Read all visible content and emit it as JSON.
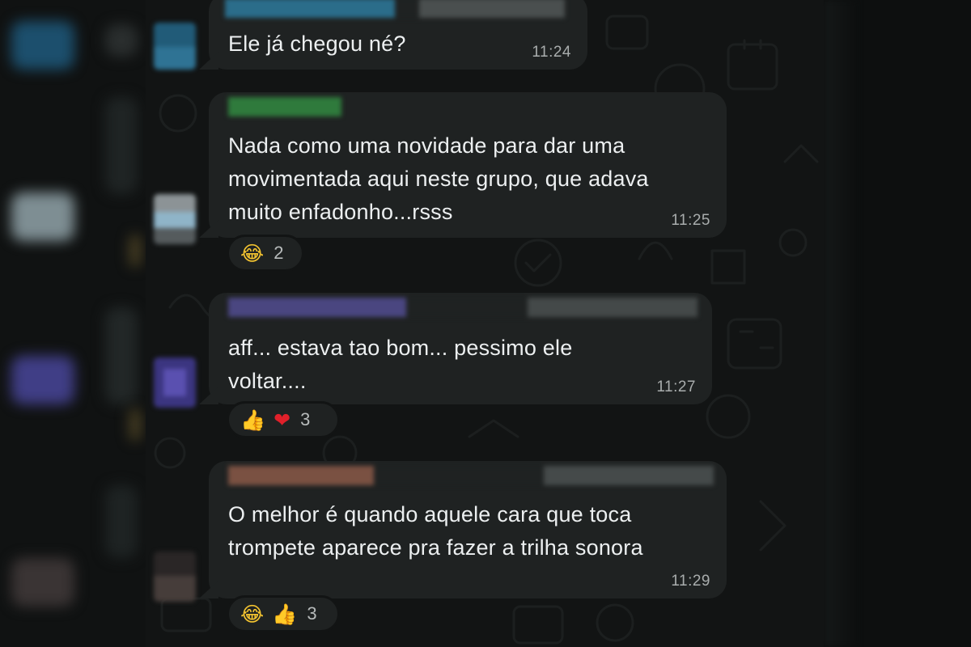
{
  "messages": [
    {
      "id": "m1",
      "text": "Ele já chegou né?",
      "time": "11:24",
      "reactions": []
    },
    {
      "id": "m2",
      "text": "Nada como uma novidade para dar uma\nmovimentada aqui neste grupo, que adava\nmuito enfadonho...rsss",
      "time": "11:25",
      "reactions": [
        {
          "icon": "laugh-emoji"
        }
      ],
      "reaction_count": "2"
    },
    {
      "id": "m3",
      "text": "aff... estava tao bom... pessimo ele\nvoltar....",
      "time": "11:27",
      "reactions": [
        {
          "icon": "thumbs-up-emoji"
        },
        {
          "icon": "heart-emoji"
        }
      ],
      "reaction_count": "3"
    },
    {
      "id": "m4",
      "text": "O melhor é quando aquele cara que toca\ntrompete aparece pra fazer a trilha sonora",
      "time": "11:29",
      "reactions": [
        {
          "icon": "laugh-emoji"
        },
        {
          "icon": "thumbs-up-emoji"
        }
      ],
      "reaction_count": "3"
    }
  ],
  "colors": {
    "chat_background": "#121414",
    "bubble": "#1f2222",
    "text": "#eceff0",
    "timestamp": "#a9adad"
  }
}
